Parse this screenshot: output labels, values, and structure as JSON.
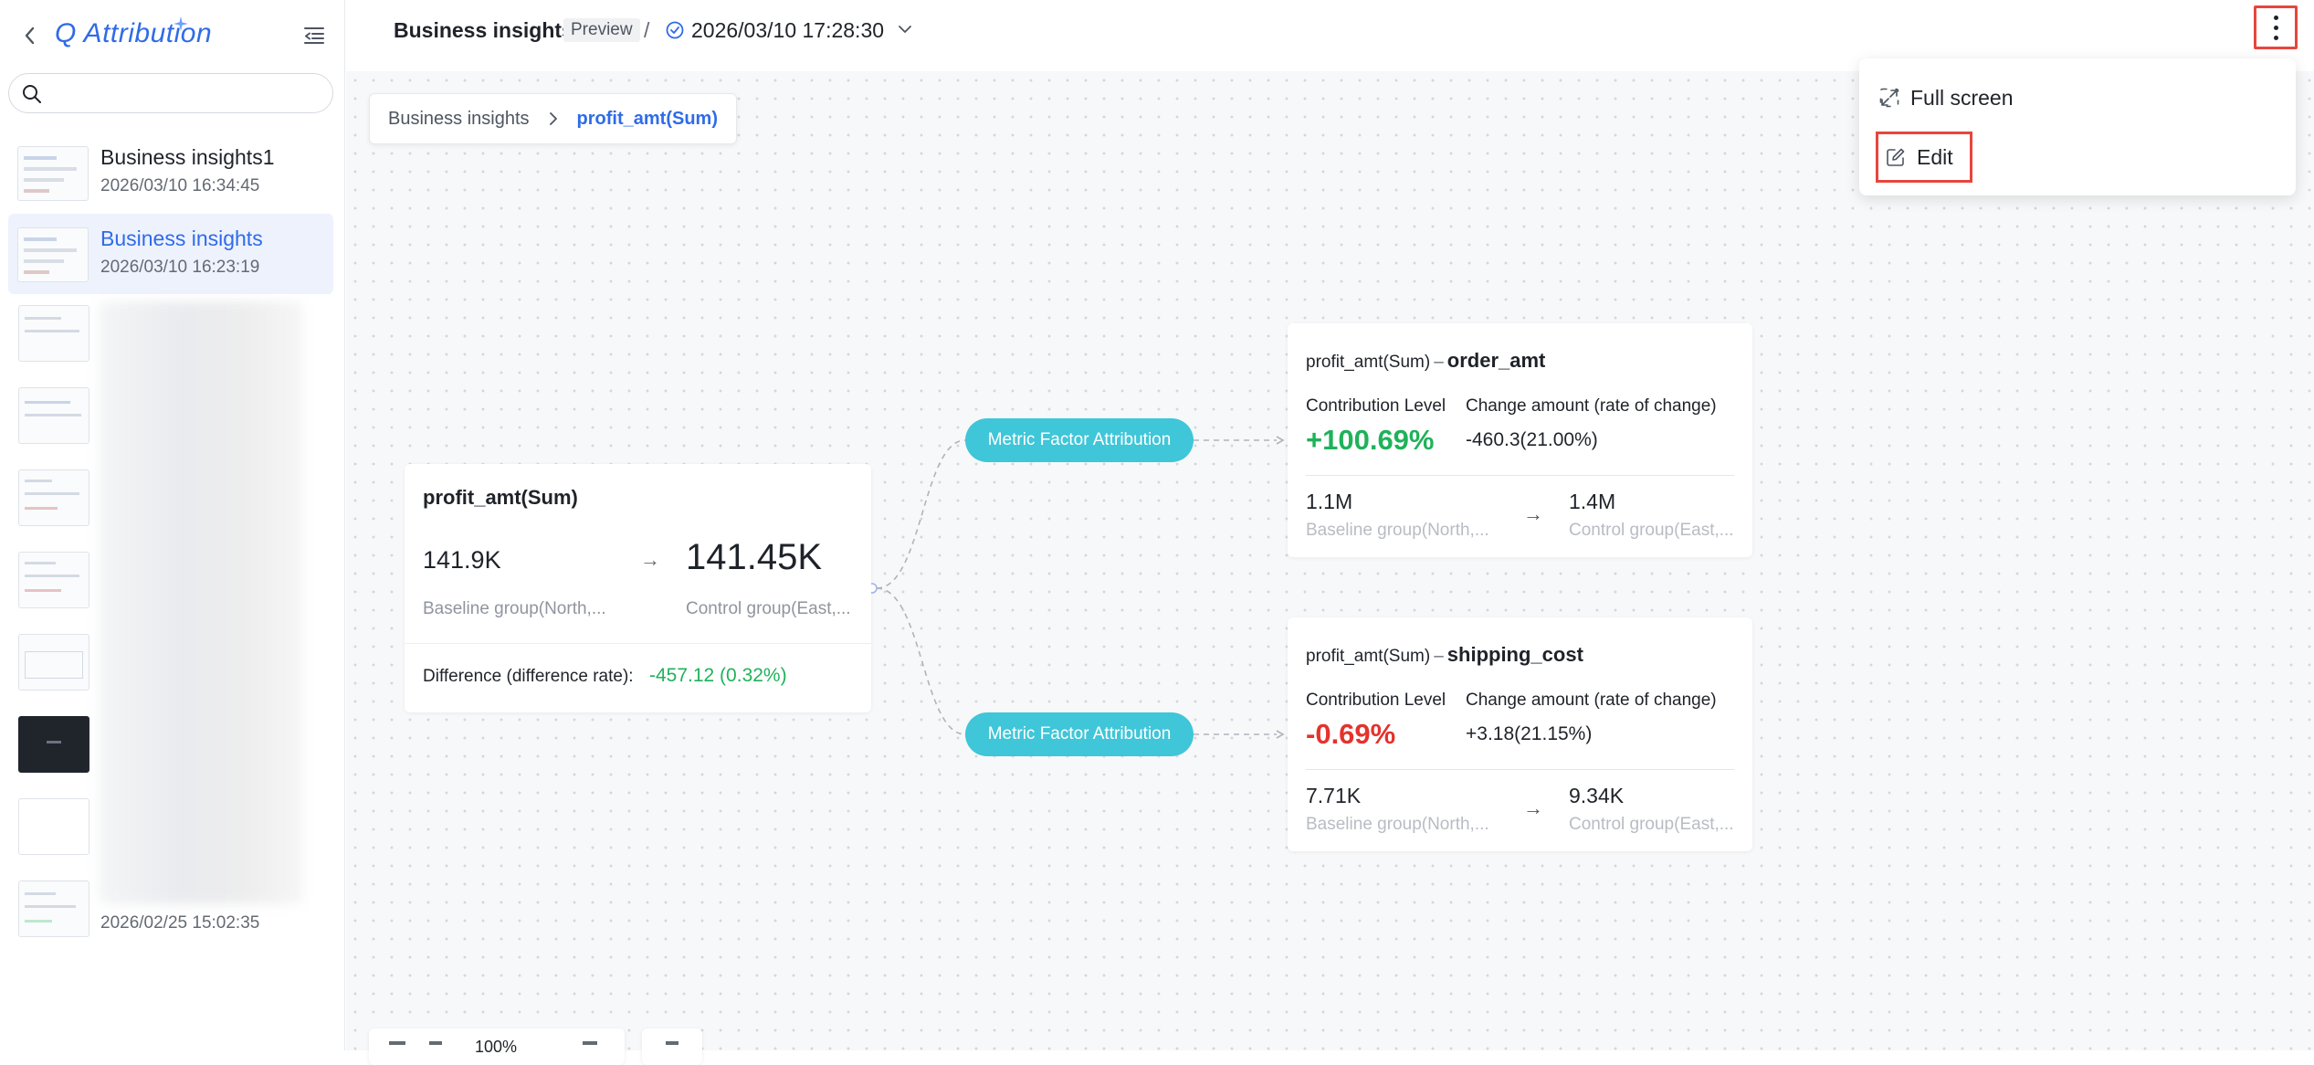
{
  "app": {
    "name": "Q Attribution"
  },
  "search": {
    "placeholder": ""
  },
  "sidebar": {
    "items": [
      {
        "title": "Business insights1",
        "date": "2026/03/10 16:34:45"
      },
      {
        "title": "Business insights",
        "date": "2026/03/10 16:23:19"
      }
    ],
    "last_date": "2026/02/25 15:02:35"
  },
  "header": {
    "title": "Business insights",
    "badge": "Preview",
    "separator": "/",
    "version_date": "2026/03/10 17:28:30"
  },
  "breadcrumb": {
    "root": "Business insights",
    "current": "profit_amt(Sum)"
  },
  "main_card": {
    "title": "profit_amt(Sum)",
    "baseline_value": "141.9K",
    "control_value": "141.45K",
    "baseline_label": "Baseline group(North,...",
    "control_label": "Control group(East,...",
    "difference_label": "Difference (difference rate):",
    "difference_value": "-457.12 (0.32%)",
    "arrow": "→"
  },
  "attribution_nodes": [
    {
      "label": "Metric Factor Attribution"
    },
    {
      "label": "Metric Factor Attribution"
    }
  ],
  "factor_cards": [
    {
      "prefix": "profit_amt(Sum)",
      "dash": "–",
      "factor": "order_amt",
      "contribution_label": "Contribution Level",
      "contribution_value": "+100.69%",
      "change_label": "Change amount (rate of change)",
      "change_value": "-460.3(21.00%)",
      "baseline_value": "1.1M",
      "control_value": "1.4M",
      "baseline_label": "Baseline group(North,...",
      "control_label": "Control group(East,...",
      "arrow": "→"
    },
    {
      "prefix": "profit_amt(Sum)",
      "dash": "–",
      "factor": "shipping_cost",
      "contribution_label": "Contribution Level",
      "contribution_value": "-0.69%",
      "change_label": "Change amount (rate of change)",
      "change_value": "+3.18(21.15%)",
      "baseline_value": "7.71K",
      "control_value": "9.34K",
      "baseline_label": "Baseline group(North,...",
      "control_label": "Control group(East,...",
      "arrow": "→"
    }
  ],
  "menu": {
    "full_screen": "Full screen",
    "edit": "Edit"
  },
  "toolbar": {
    "zoom": "100%"
  },
  "colors": {
    "accent": "#2f6be8",
    "positive": "#1fb25a",
    "negative": "#e5322d",
    "pill": "#3fc6d8",
    "highlight": "#e8453c"
  }
}
